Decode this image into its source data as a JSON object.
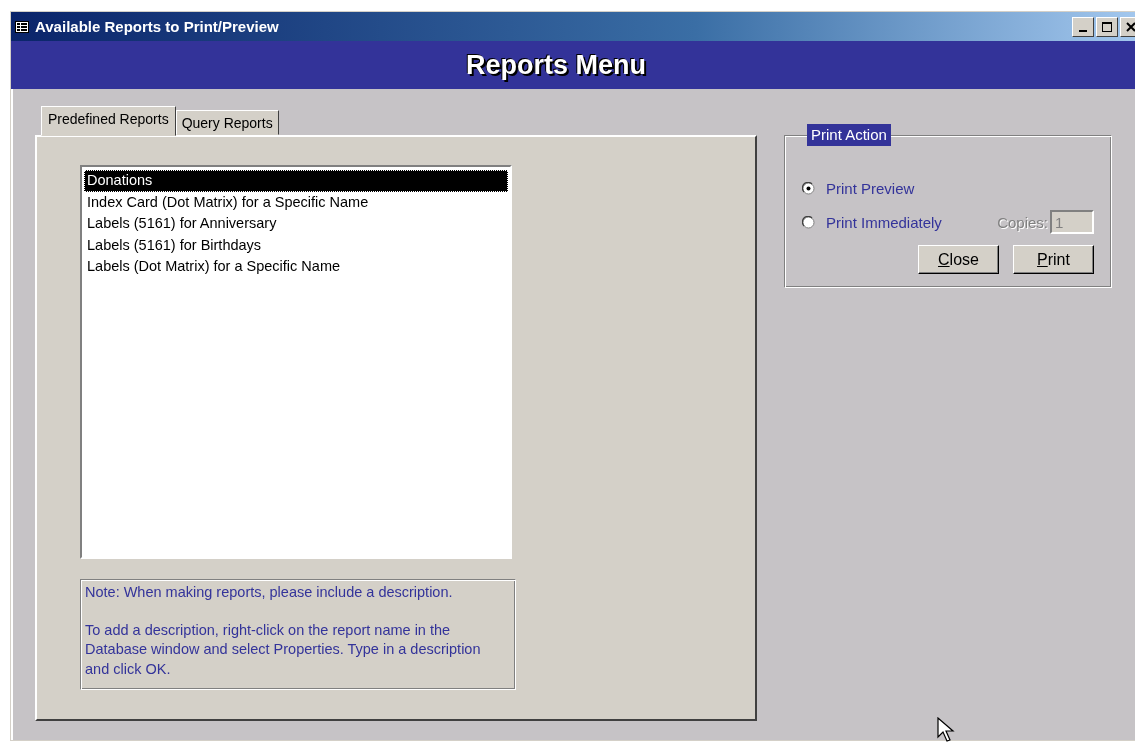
{
  "window": {
    "title": "Available Reports to Print/Preview"
  },
  "header": {
    "title": "Reports Menu"
  },
  "tabs": [
    {
      "label": "Predefined Reports",
      "selected": true
    },
    {
      "label": "Query Reports",
      "selected": false
    }
  ],
  "reports": [
    {
      "label": "Donations",
      "selected": true
    },
    {
      "label": "Index Card (Dot Matrix) for a Specific Name",
      "selected": false
    },
    {
      "label": "Labels (5161) for Anniversary",
      "selected": false
    },
    {
      "label": "Labels (5161) for Birthdays",
      "selected": false
    },
    {
      "label": "Labels (Dot Matrix) for a Specific Name",
      "selected": false
    }
  ],
  "note": [
    "Note: When making reports, please include a description.",
    "To add a description, right-click on the report name in the Database window and select Properties. Type in a description and click OK."
  ],
  "print_action": {
    "title": "Print Action",
    "options": [
      {
        "label": "Print Preview",
        "selected": true
      },
      {
        "label": "Print Immediately",
        "selected": false
      }
    ],
    "copies": {
      "label": "Copies:",
      "value": "1",
      "disabled": true
    },
    "buttons": [
      {
        "label": "Close",
        "access_key_underlined": true
      },
      {
        "label": "Print",
        "access_key_underlined": true
      }
    ]
  }
}
